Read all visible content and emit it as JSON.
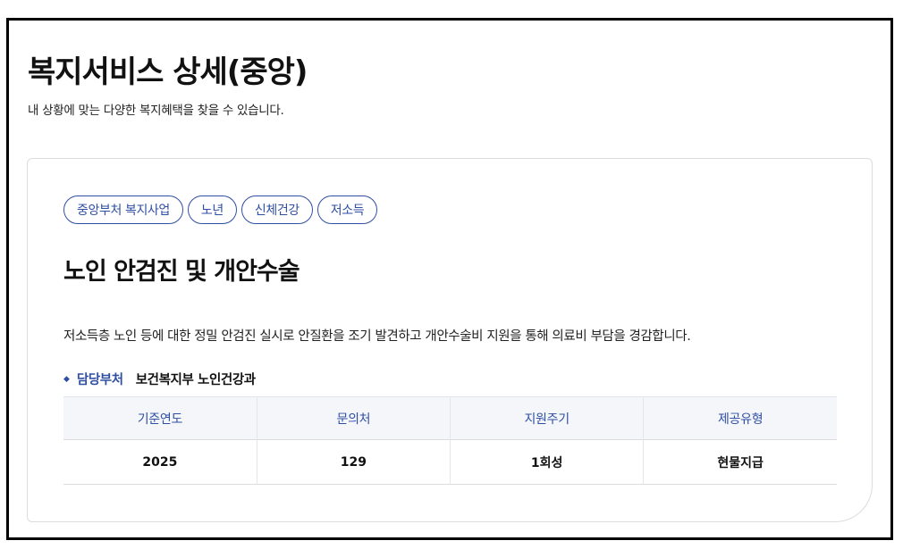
{
  "header": {
    "title": "복지서비스 상세(중앙)",
    "subtitle": "내 상황에 맞는 다양한 복지혜택을 찾을 수 있습니다."
  },
  "service": {
    "tags": [
      "중앙부처 복지사업",
      "노년",
      "신체건강",
      "저소득"
    ],
    "title": "노인 안검진 및 개안수술",
    "description": "저소득층 노인 등에 대한 정밀 안검진 실시로 안질환을 조기 발견하고 개안수술비 지원을 통해 의료비 부담을 경감합니다.",
    "department_label": "담당부처",
    "department_value": "보건복지부 노인건강과"
  },
  "info_table": {
    "headers": [
      "기준연도",
      "문의처",
      "지원주기",
      "제공유형"
    ],
    "values": [
      "2025",
      "129",
      "1회성",
      "현물지급"
    ]
  },
  "colors": {
    "accent": "#2f4fa3",
    "table_header_bg": "#f4f6fa",
    "frame_border": "#000000"
  }
}
